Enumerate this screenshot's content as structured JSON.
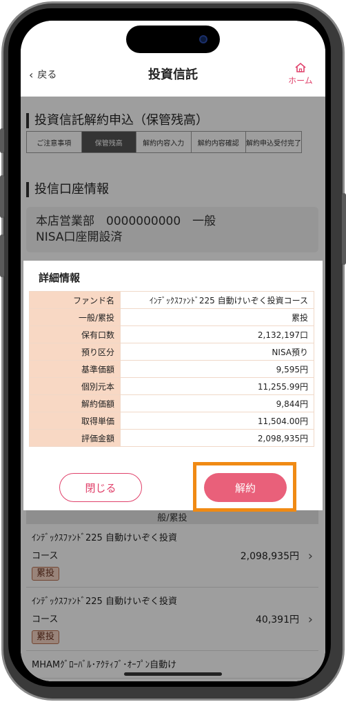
{
  "header": {
    "back_label": "戻る",
    "title": "投資信託",
    "home_label": "ホーム"
  },
  "section1": {
    "title": "投資信託解約申込（保管残高）",
    "steps": [
      "ご注意事項",
      "保管残高",
      "解約内容入力",
      "解約内容確認",
      "解約申込受付完了"
    ],
    "active_step": 1
  },
  "section2": {
    "title": "投信口座情報",
    "account_line1": "本店営業部　0000000000　一般",
    "account_line2": "NISA口座開設済"
  },
  "modal": {
    "title": "詳細情報",
    "rows": [
      {
        "label": "ファンド名",
        "value": "ｲﾝﾃﾞｯｸｽﾌｧﾝﾄﾞ225 自動けいぞく投資コース"
      },
      {
        "label": "一般/累投",
        "value": "累投"
      },
      {
        "label": "保有口数",
        "value": "2,132,197口"
      },
      {
        "label": "預り区分",
        "value": "NISA預り"
      },
      {
        "label": "基準価額",
        "value": "9,595円"
      },
      {
        "label": "個別元本",
        "value": "11,255.99円"
      },
      {
        "label": "解約価額",
        "value": "9,844円"
      },
      {
        "label": "取得単価",
        "value": "11,504.00円"
      },
      {
        "label": "評価金額",
        "value": "2,098,935円"
      }
    ],
    "close_label": "閉じる",
    "cancel_label": "解約",
    "highlight_color": "#f08a14"
  },
  "list": {
    "header": "般/累投",
    "funds": [
      {
        "name1": "ｲﾝﾃﾞｯｸｽﾌｧﾝﾄﾞ225 自動けいぞく投資",
        "name2": "コース",
        "badge": "累投",
        "value": "2,098,935円"
      },
      {
        "name1": "ｲﾝﾃﾞｯｸｽﾌｧﾝﾄﾞ225 自動けいぞく投資",
        "name2": "コース",
        "badge": "累投",
        "value": "40,391円"
      },
      {
        "name1": "MHAMｸﾞﾛｰﾊﾞﾙ･ｱｸﾃｨﾌﾞ･ｵｰﾌﾟﾝ自動け",
        "name2": "",
        "badge": "",
        "value": ""
      }
    ]
  },
  "colors": {
    "accent": "#e0406a",
    "button": "#e9607a",
    "table_label_bg": "#f8d8c4"
  },
  "icons": {
    "back": "chevron-left-icon",
    "home": "home-icon",
    "row": "chevron-right-icon"
  }
}
